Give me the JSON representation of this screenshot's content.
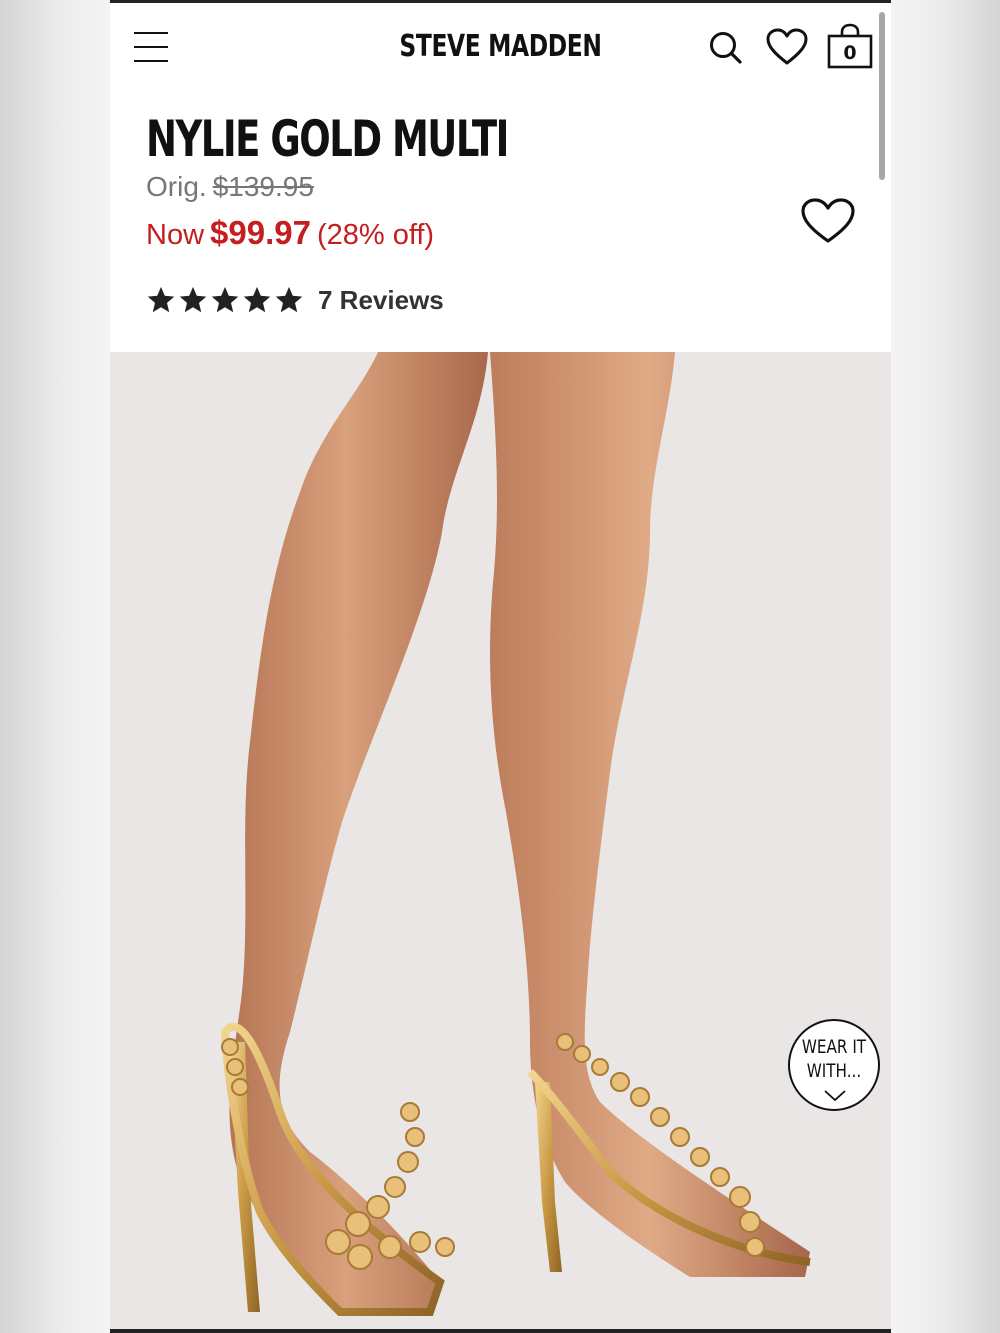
{
  "header": {
    "brand": "STEVE MADDEN",
    "cart_count": "0",
    "icons": [
      "hamburger-menu-icon",
      "search-icon",
      "heart-icon",
      "shopping-bag-icon"
    ]
  },
  "product": {
    "title": "NYLIE GOLD MULTI",
    "orig_label": "Orig.",
    "orig_price": "$139.95",
    "now_label": "Now",
    "now_price": "$99.97",
    "discount": "(28% off)",
    "rating": 5,
    "reviews_label": "7 Reviews"
  },
  "wear_it": {
    "line1": "WEAR IT",
    "line2": "WITH..."
  },
  "colors": {
    "sale_red": "#c41e1e",
    "text_dark": "#111111",
    "text_gray": "#777777",
    "image_bg": "#e9e6e5"
  }
}
